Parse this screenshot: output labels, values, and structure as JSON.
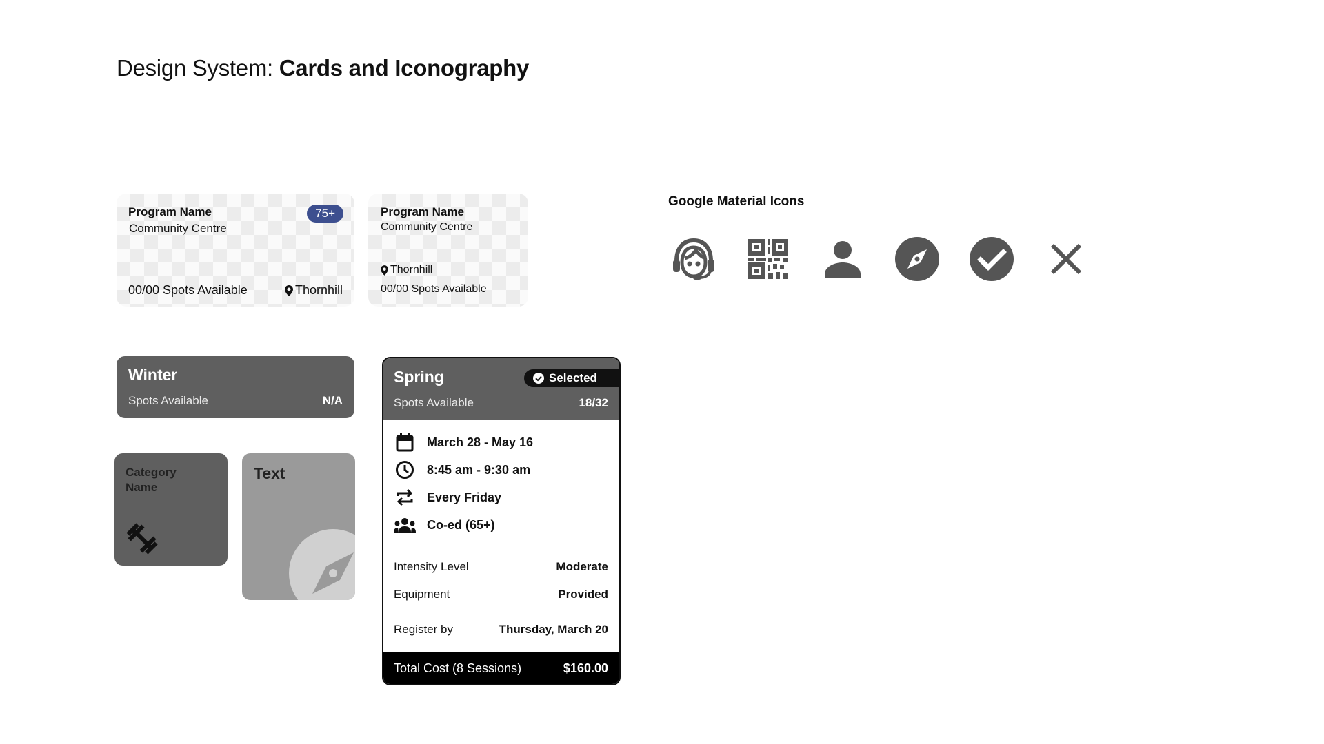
{
  "page": {
    "title_prefix": "Design System: ",
    "title_bold": "Cards and Iconography"
  },
  "program_card_1": {
    "name": "Program Name",
    "centre": "Community Centre",
    "badge": "75+",
    "spots": "00/00 Spots Available",
    "location": "Thornhill",
    "badge_color": "#3d4f8f"
  },
  "program_card_2": {
    "name": "Program Name",
    "centre": "Community Centre",
    "location": "Thornhill",
    "spots": "00/00 Spots Available"
  },
  "icons_section": {
    "label": "Google Material Icons",
    "icons": [
      "support-agent-icon",
      "qr-code-icon",
      "person-icon",
      "explore-icon",
      "check-circle-icon",
      "close-icon"
    ],
    "icon_color": "#555555"
  },
  "winter_card": {
    "season": "Winter",
    "spots_label": "Spots Available",
    "spots_value": "N/A"
  },
  "category_tile": {
    "name": "Category Name",
    "icon": "fitness-center-icon"
  },
  "text_tile": {
    "label": "Text",
    "icon": "explore-icon"
  },
  "spring_card": {
    "season": "Spring",
    "selected_label": "Selected",
    "spots_label": "Spots Available",
    "spots_value": "18/32",
    "date_range": "March 28 - May 16",
    "time_range": "8:45 am - 9:30 am",
    "recurrence": "Every Friday",
    "group": "Co-ed (65+)",
    "intensity_label": "Intensity Level",
    "intensity_value": "Moderate",
    "equipment_label": "Equipment",
    "equipment_value": "Provided",
    "register_label": "Register by",
    "register_value": "Thursday, March 20",
    "total_label": "Total Cost (8 Sessions)",
    "total_value": "$160.00"
  }
}
